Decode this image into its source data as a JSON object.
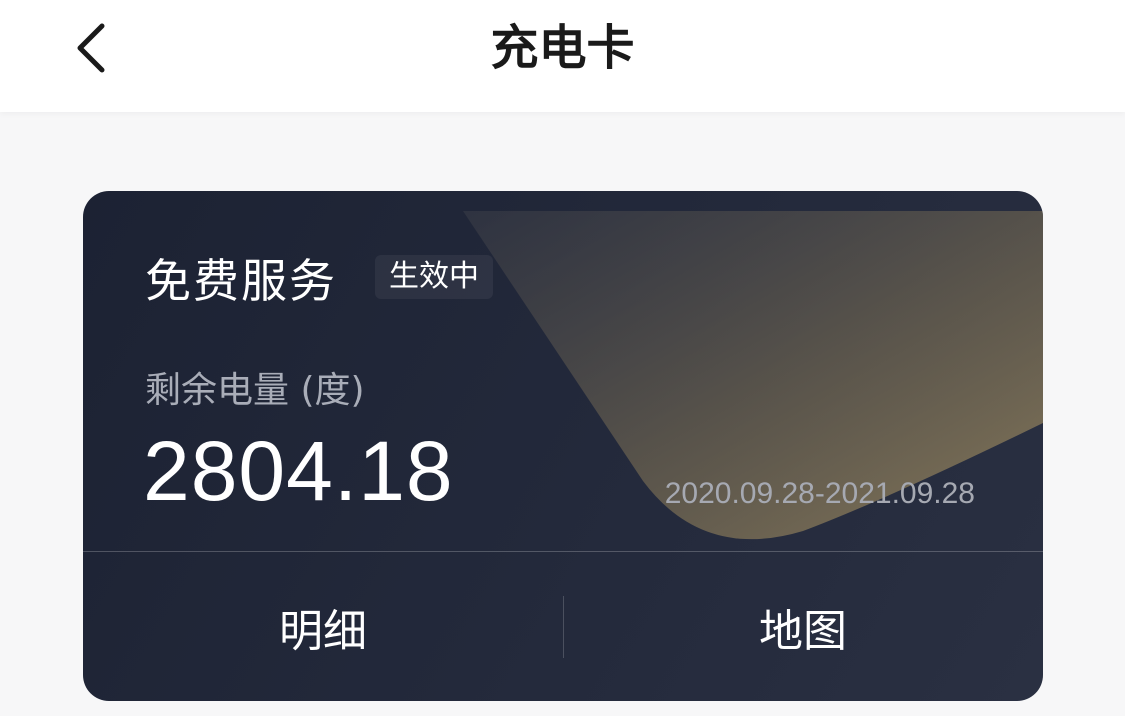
{
  "header": {
    "title": "充电卡",
    "back_icon": "chevron-left-icon"
  },
  "card": {
    "service_name": "免费服务",
    "status": "生效中",
    "balance_label": "剩余电量 (度)",
    "balance_value": "2804.18",
    "validity_period": "2020.09.28-2021.09.28",
    "actions": {
      "details_label": "明细",
      "map_label": "地图"
    }
  },
  "colors": {
    "card_background": "#1f2536",
    "accent_gold": "#8a7a5a",
    "text_primary": "#ffffff",
    "text_secondary": "#a9adb8"
  }
}
